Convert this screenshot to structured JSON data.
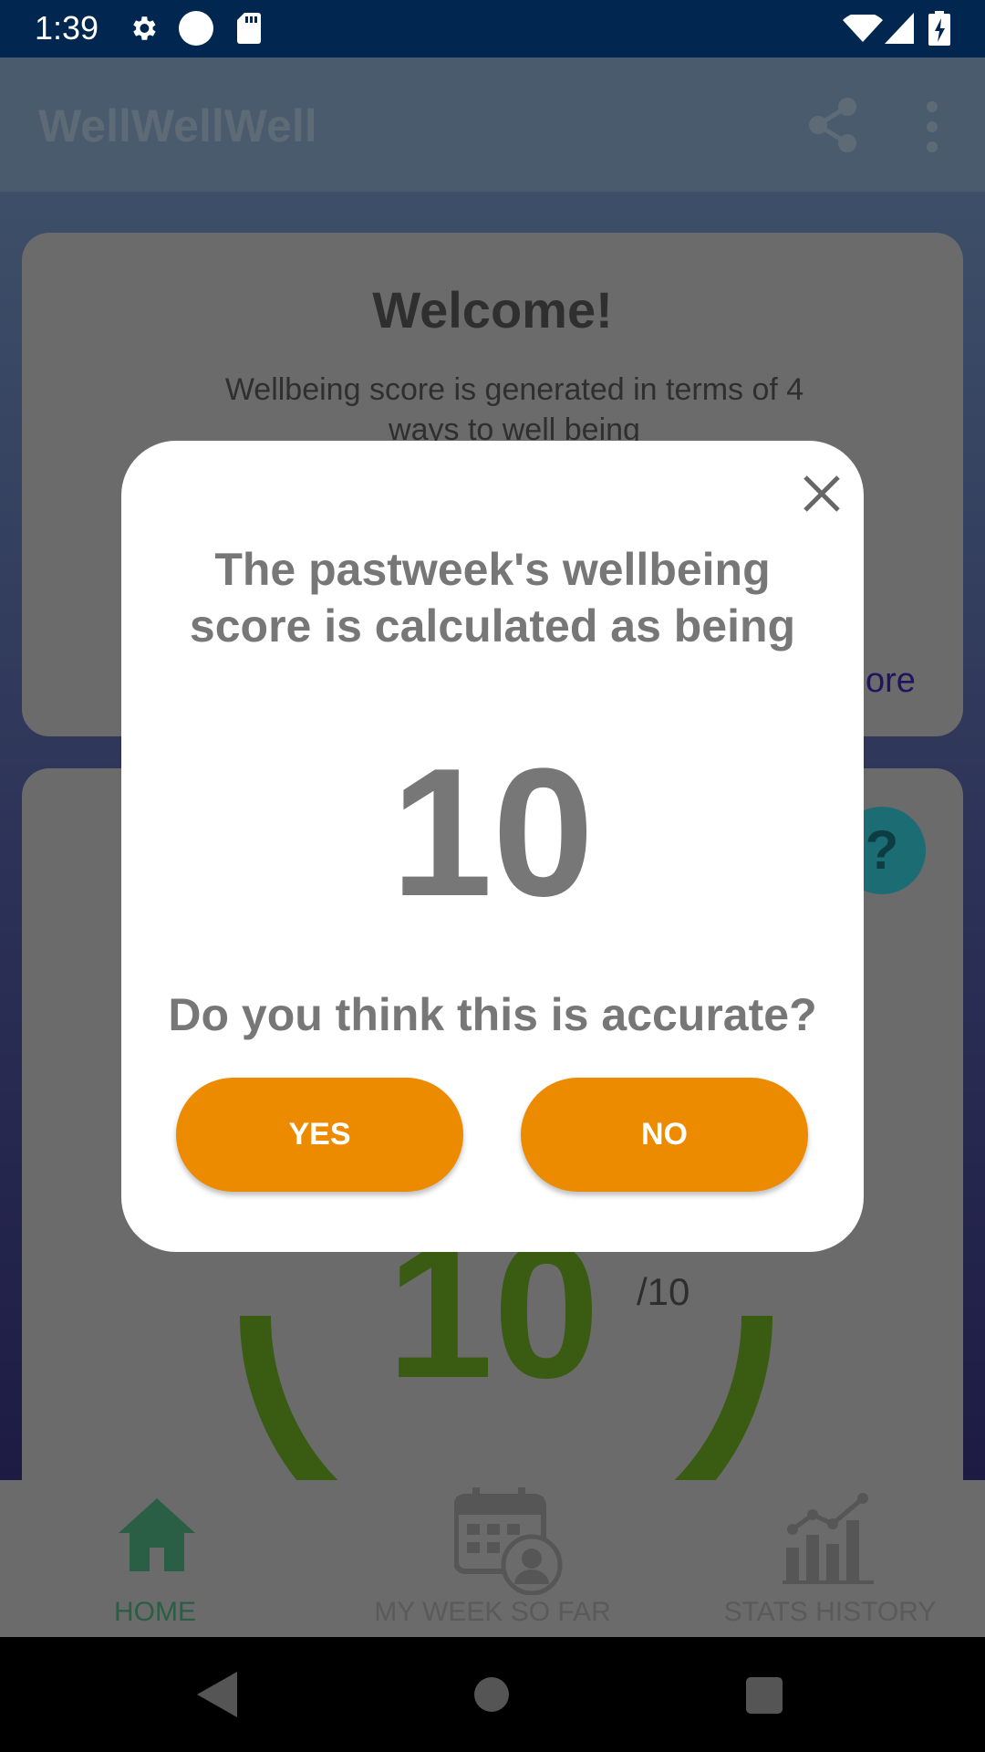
{
  "status_bar": {
    "time": "1:39",
    "icons": [
      "gear-icon",
      "circle-icon",
      "sd-card-icon",
      "wifi-icon",
      "signal-icon",
      "battery-charging-icon"
    ]
  },
  "app_bar": {
    "title": "WellWellWell",
    "actions": [
      "share-icon",
      "more-vert-icon"
    ]
  },
  "welcome_card": {
    "title": "Welcome!",
    "text": "Wellbeing score is generated in terms of 4 ways to well being",
    "learn_more_partial": "ore"
  },
  "score_card": {
    "score": "10",
    "out_of": "/10",
    "help_icon": "help-icon"
  },
  "dialog": {
    "message": "The pastweek's wellbeing score is calculated as being",
    "score": "10",
    "question": "Do you think this is accurate?",
    "yes_label": "YES",
    "no_label": "NO",
    "close_icon": "close-icon"
  },
  "bottom_nav": {
    "items": [
      {
        "label": "HOME",
        "icon": "home-icon",
        "active": true
      },
      {
        "label": "MY WEEK SO FAR",
        "icon": "calendar-person-icon",
        "active": false
      },
      {
        "label": "STATS HISTORY",
        "icon": "chart-icon",
        "active": false
      }
    ]
  },
  "colors": {
    "accent": "#ec8a00",
    "status_bar": "#012750",
    "home_active": "#2a5e45",
    "score_ring": "#3a5b12",
    "help": "#1c6c73"
  }
}
